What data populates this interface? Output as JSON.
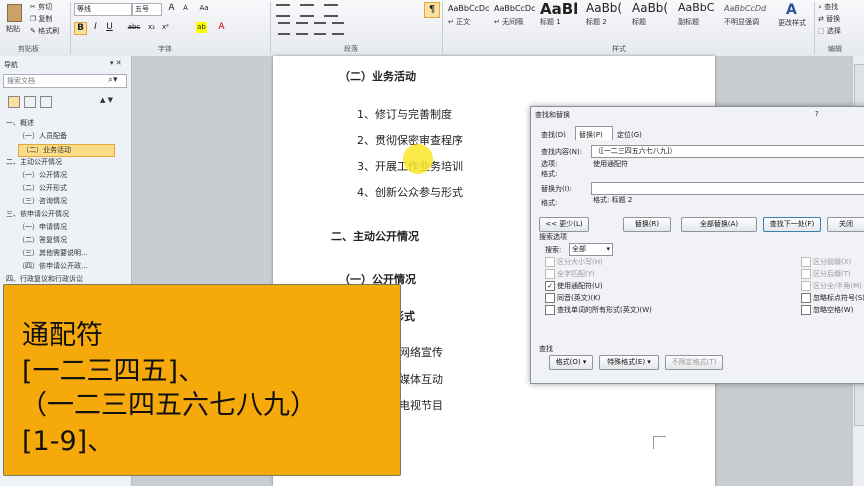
{
  "ribbon": {
    "clipboard": {
      "paste": "粘贴",
      "cut": "剪切",
      "copy": "复制",
      "format_painter": "格式刷",
      "group": "剪贴板"
    },
    "font": {
      "font_name": "等线",
      "font_size": "五号",
      "group": "字体",
      "bold": "B",
      "italic": "I",
      "underline": "U",
      "strike": "abc",
      "sub": "x₂",
      "sup": "x²",
      "grow": "A",
      "shrink": "A",
      "aa": "Aa",
      "color": "A"
    },
    "paragraph": {
      "group": "段落"
    },
    "styles": {
      "group": "样式",
      "items": [
        {
          "sample": "AaBbCcDc",
          "name": "↵ 正文"
        },
        {
          "sample": "AaBbCcDc",
          "name": "↵ 无间隔"
        },
        {
          "sample": "AaBl",
          "name": "标题 1"
        },
        {
          "sample": "AaBb(",
          "name": "标题 2"
        },
        {
          "sample": "AaBb(",
          "name": "标题"
        },
        {
          "sample": "AaBbC",
          "name": "副标题"
        },
        {
          "sample": "AaBbCcDd",
          "name": "不明显强调"
        }
      ],
      "change_styles": "更改样式"
    },
    "editing": {
      "find": "查找",
      "replace": "替换",
      "select": "选择",
      "group": "编辑"
    }
  },
  "nav": {
    "title": "导航",
    "search_placeholder": "搜索文档",
    "items": [
      {
        "label": "一、概述",
        "level": 0,
        "selected": false
      },
      {
        "label": "（一）人员配备",
        "level": 1,
        "selected": false
      },
      {
        "label": "（二）业务活动",
        "level": 1,
        "selected": true
      },
      {
        "label": "二、主动公开情况",
        "level": 0,
        "selected": false
      },
      {
        "label": "（一）公开情况",
        "level": 1,
        "selected": false
      },
      {
        "label": "（二）公开形式",
        "level": 1,
        "selected": false
      },
      {
        "label": "（三）咨询情况",
        "level": 1,
        "selected": false
      },
      {
        "label": "三、依申请公开情况",
        "level": 0,
        "selected": false
      },
      {
        "label": "（一）申请情况",
        "level": 1,
        "selected": false
      },
      {
        "label": "（二）答复情况",
        "level": 1,
        "selected": false
      },
      {
        "label": "（三）其他需要说明...",
        "level": 1,
        "selected": false
      },
      {
        "label": "（四）依申请公开政...",
        "level": 1,
        "selected": false
      },
      {
        "label": "四、行政复议和行政诉讼",
        "level": 0,
        "selected": false
      }
    ]
  },
  "document": {
    "lines": [
      {
        "text": "（二）业务活动",
        "bold": true
      },
      {
        "text": "1、修订与完善制度",
        "bold": false
      },
      {
        "text": "2、贯彻保密审查程序",
        "bold": false
      },
      {
        "text": "3、开展工作业务培训",
        "bold": false
      },
      {
        "text": "4、创新公众参与形式",
        "bold": false
      },
      {
        "text": "二、主动公开情况",
        "bold": true
      },
      {
        "text": "（一）公开情况",
        "bold": true
      },
      {
        "text": "形式",
        "bold": true
      },
      {
        "text": "网络宣传",
        "bold": false
      },
      {
        "text": "媒体互动",
        "bold": false
      },
      {
        "text": "电视节目",
        "bold": false
      }
    ]
  },
  "dialog": {
    "title": "查找和替换",
    "help": "?",
    "tabs": [
      {
        "label": "查找(D)",
        "active": false
      },
      {
        "label": "替换(P)",
        "active": true
      },
      {
        "label": "定位(G)",
        "active": false
      }
    ],
    "find_label": "查找内容(N):",
    "find_value": "（[一二三四五六七八九]）",
    "options_label": "选项:",
    "options_value": "使用通配符",
    "format_label": "格式:",
    "replace_label": "替换为(I):",
    "replace_value": "",
    "replace_format_label": "格式:",
    "replace_format_value": "标题 2",
    "buttons": {
      "less": "<< 更少(L)",
      "replace": "替换(R)",
      "replace_all": "全部替换(A)",
      "find_next": "查找下一处(F)",
      "close": "关闭"
    },
    "search_options": "搜索选项",
    "search_label": "搜索:",
    "search_value": "全部",
    "checks_left": [
      {
        "label": "区分大小写(H)",
        "checked": false,
        "disabled": true
      },
      {
        "label": "全字匹配(Y)",
        "checked": false,
        "disabled": true
      },
      {
        "label": "使用通配符(U)",
        "checked": true,
        "disabled": false
      },
      {
        "label": "同音(英文)(K)",
        "checked": false,
        "disabled": false
      },
      {
        "label": "查找单词的所有形式(英文)(W)",
        "checked": false,
        "disabled": false
      }
    ],
    "checks_right": [
      {
        "label": "区分前缀(X)",
        "checked": false,
        "disabled": true
      },
      {
        "label": "区分后缀(T)",
        "checked": false,
        "disabled": true
      },
      {
        "label": "区分全/半角(M)",
        "checked": false,
        "disabled": true
      },
      {
        "label": "忽略标点符号(S)",
        "checked": false,
        "disabled": false
      },
      {
        "label": "忽略空格(W)",
        "checked": false,
        "disabled": false
      }
    ],
    "find_section": "查找",
    "bottom_buttons": {
      "format": "格式(O) ▾",
      "special": "特殊格式(E) ▾",
      "no_format": "不限定格式(T)"
    }
  },
  "overlay": {
    "lines": [
      "通配符",
      "[一二三四五]、",
      "（一二三四五六七八九）",
      "[1-9]、"
    ]
  },
  "colors": {
    "overlay_bg": "#f5a90a",
    "nav_selected": "#fbdc87",
    "page": "#ffffff"
  }
}
